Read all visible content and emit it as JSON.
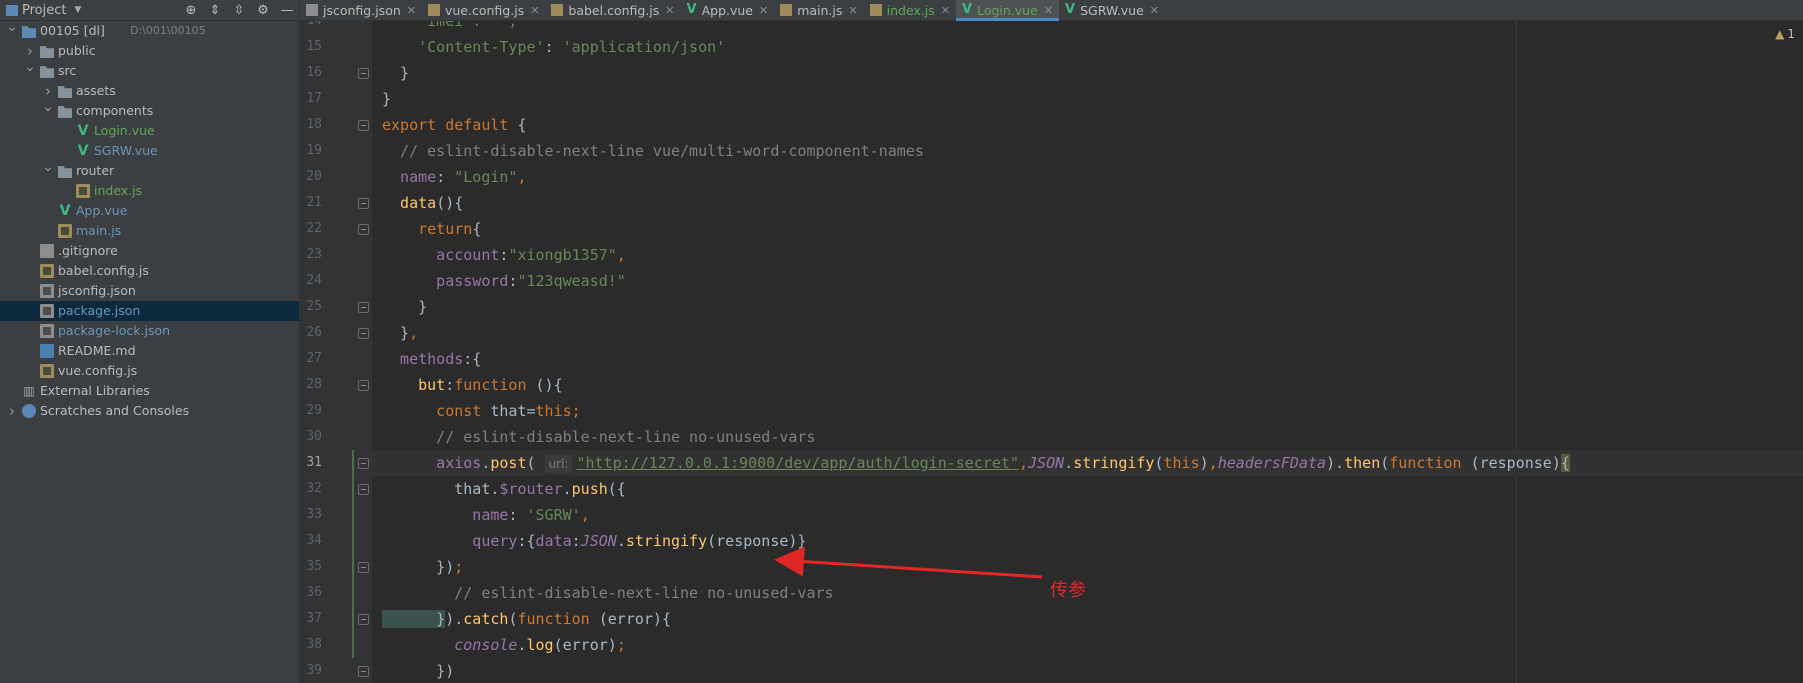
{
  "panel": {
    "title": "Project",
    "tree": [
      {
        "label": "00105 [dl]",
        "extra": "D:\\001\\00105",
        "icon": "project-folder-icon",
        "depth": 0,
        "arrow": "down",
        "color": "default"
      },
      {
        "label": "public",
        "icon": "folder-icon",
        "depth": 1,
        "arrow": "right",
        "color": "default"
      },
      {
        "label": "src",
        "icon": "folder-icon",
        "depth": 1,
        "arrow": "down",
        "color": "default"
      },
      {
        "label": "assets",
        "icon": "folder-icon",
        "depth": 2,
        "arrow": "right",
        "color": "default"
      },
      {
        "label": "components",
        "icon": "folder-icon",
        "depth": 2,
        "arrow": "down",
        "color": "default"
      },
      {
        "label": "Login.vue",
        "icon": "vue-icon",
        "depth": 3,
        "arrow": "",
        "color": "green"
      },
      {
        "label": "SGRW.vue",
        "icon": "vue-icon",
        "depth": 3,
        "arrow": "",
        "color": "blue"
      },
      {
        "label": "router",
        "icon": "folder-icon",
        "depth": 2,
        "arrow": "down",
        "color": "default"
      },
      {
        "label": "index.js",
        "icon": "js-icon",
        "depth": 3,
        "arrow": "",
        "color": "green"
      },
      {
        "label": "App.vue",
        "icon": "vue-icon",
        "depth": 2,
        "arrow": "",
        "color": "blue"
      },
      {
        "label": "main.js",
        "icon": "js-icon",
        "depth": 2,
        "arrow": "",
        "color": "blue"
      },
      {
        "label": ".gitignore",
        "icon": "git-icon",
        "depth": 1,
        "arrow": "",
        "color": "default"
      },
      {
        "label": "babel.config.js",
        "icon": "js-icon",
        "depth": 1,
        "arrow": "",
        "color": "default"
      },
      {
        "label": "jsconfig.json",
        "icon": "json-icon",
        "depth": 1,
        "arrow": "",
        "color": "default"
      },
      {
        "label": "package.json",
        "icon": "json-icon",
        "depth": 1,
        "arrow": "",
        "color": "blue",
        "selected": true
      },
      {
        "label": "package-lock.json",
        "icon": "json-icon",
        "depth": 1,
        "arrow": "",
        "color": "blue"
      },
      {
        "label": "README.md",
        "icon": "md-icon",
        "depth": 1,
        "arrow": "",
        "color": "default"
      },
      {
        "label": "vue.config.js",
        "icon": "js-icon",
        "depth": 1,
        "arrow": "",
        "color": "default"
      },
      {
        "label": "External Libraries",
        "icon": "lib-icon",
        "depth": 0,
        "arrow": "",
        "color": "default"
      },
      {
        "label": "Scratches and Consoles",
        "icon": "scratch-icon",
        "depth": 0,
        "arrow": "right",
        "color": "default"
      }
    ]
  },
  "tabs": [
    {
      "label": "jsconfig.json",
      "icon": "json",
      "active": false,
      "green": false
    },
    {
      "label": "vue.config.js",
      "icon": "js",
      "active": false,
      "green": false
    },
    {
      "label": "babel.config.js",
      "icon": "js",
      "active": false,
      "green": false
    },
    {
      "label": "App.vue",
      "icon": "vue",
      "active": false,
      "green": false
    },
    {
      "label": "main.js",
      "icon": "js",
      "active": false,
      "green": false
    },
    {
      "label": "index.js",
      "icon": "js",
      "active": false,
      "green": true
    },
    {
      "label": "Login.vue",
      "icon": "vue",
      "active": true,
      "green": true
    },
    {
      "label": "SGRW.vue",
      "icon": "vue",
      "active": false,
      "green": false
    }
  ],
  "editor": {
    "warning_count": "1",
    "current_line": 31,
    "lines": [
      {
        "n": "14",
        "tokens": [
          [
            "str",
            "    'imei': '',"
          ]
        ]
      },
      {
        "n": "15",
        "tokens": [
          [
            "str",
            "    'Content-Type'"
          ],
          [
            "plain",
            ": "
          ],
          [
            "str",
            "'application/json'"
          ]
        ]
      },
      {
        "n": "16",
        "tokens": [
          [
            "plain",
            "  }"
          ]
        ]
      },
      {
        "n": "17",
        "tokens": [
          [
            "plain",
            "}"
          ]
        ]
      },
      {
        "n": "18",
        "tokens": [
          [
            "kw",
            "export default "
          ],
          [
            "plain",
            "{"
          ]
        ]
      },
      {
        "n": "19",
        "tokens": [
          [
            "cmt",
            "  // eslint-disable-next-line vue/multi-word-component-names"
          ]
        ]
      },
      {
        "n": "20",
        "tokens": [
          [
            "prop",
            "  name"
          ],
          [
            "plain",
            ": "
          ],
          [
            "str",
            "\"Login\""
          ],
          [
            "kw",
            ","
          ]
        ]
      },
      {
        "n": "21",
        "tokens": [
          [
            "fn",
            "  data"
          ],
          [
            "plain",
            "(){"
          ]
        ]
      },
      {
        "n": "22",
        "tokens": [
          [
            "kw",
            "    return"
          ],
          [
            "plain",
            "{"
          ]
        ]
      },
      {
        "n": "23",
        "tokens": [
          [
            "prop",
            "      account"
          ],
          [
            "plain",
            ":"
          ],
          [
            "str",
            "\"xiongb1357\""
          ],
          [
            "kw",
            ","
          ]
        ]
      },
      {
        "n": "24",
        "tokens": [
          [
            "prop",
            "      password"
          ],
          [
            "plain",
            ":"
          ],
          [
            "str",
            "\"123qweasd!\""
          ]
        ]
      },
      {
        "n": "25",
        "tokens": [
          [
            "plain",
            "    }"
          ]
        ]
      },
      {
        "n": "26",
        "tokens": [
          [
            "plain",
            "  }"
          ],
          [
            "kw",
            ","
          ]
        ]
      },
      {
        "n": "27",
        "tokens": [
          [
            "prop",
            "  methods"
          ],
          [
            "plain",
            ":{"
          ]
        ]
      },
      {
        "n": "28",
        "tokens": [
          [
            "fn",
            "    but"
          ],
          [
            "plain",
            ":"
          ],
          [
            "kw",
            "function "
          ],
          [
            "plain",
            "(){"
          ]
        ]
      },
      {
        "n": "29",
        "tokens": [
          [
            "kw",
            "      const "
          ],
          [
            "plain",
            "that="
          ],
          [
            "kw",
            "this;"
          ]
        ]
      },
      {
        "n": "30",
        "tokens": [
          [
            "cmt",
            "      // eslint-disable-next-line no-unused-vars"
          ]
        ]
      },
      {
        "n": "31",
        "tokens": [
          [
            "prop",
            "      axios"
          ],
          [
            "plain",
            "."
          ],
          [
            "fn",
            "post"
          ],
          [
            "plain",
            "( "
          ],
          [
            "hint",
            "url:"
          ],
          [
            "strul",
            "\"http://127.0.0.1:9000/dev/app/auth/login-secret\""
          ],
          [
            "kw",
            ","
          ],
          [
            "ital",
            "JSON"
          ],
          [
            "plain",
            "."
          ],
          [
            "fn",
            "stringify"
          ],
          [
            "plain",
            "("
          ],
          [
            "kw",
            "this"
          ],
          [
            "plain",
            ")"
          ],
          [
            "kw",
            ","
          ],
          [
            "ital",
            "headersFData"
          ],
          [
            "plain",
            ")."
          ],
          [
            "fn",
            "then"
          ],
          [
            "plain",
            "("
          ],
          [
            "kw",
            "function "
          ],
          [
            "plain",
            "(response)"
          ],
          [
            "caret",
            "{"
          ]
        ]
      },
      {
        "n": "32",
        "tokens": [
          [
            "plain",
            "        that."
          ],
          [
            "prop",
            "$router"
          ],
          [
            "plain",
            "."
          ],
          [
            "fn",
            "push"
          ],
          [
            "plain",
            "({"
          ]
        ]
      },
      {
        "n": "33",
        "tokens": [
          [
            "prop",
            "          name"
          ],
          [
            "plain",
            ": "
          ],
          [
            "str",
            "'SGRW'"
          ],
          [
            "kw",
            ","
          ]
        ]
      },
      {
        "n": "34",
        "tokens": [
          [
            "prop",
            "          query"
          ],
          [
            "plain",
            ":{"
          ],
          [
            "prop",
            "data"
          ],
          [
            "plain",
            ":"
          ],
          [
            "ital",
            "JSON"
          ],
          [
            "plain",
            "."
          ],
          [
            "fn",
            "stringify"
          ],
          [
            "plain",
            "(response)}"
          ]
        ]
      },
      {
        "n": "35",
        "tokens": [
          [
            "plain",
            "      })"
          ],
          [
            "kw",
            ";"
          ]
        ]
      },
      {
        "n": "36",
        "tokens": [
          [
            "cmt",
            "        // eslint-disable-next-line no-unused-vars"
          ]
        ]
      },
      {
        "n": "37",
        "tokens": [
          [
            "match",
            "      }"
          ],
          [
            "plain",
            ")."
          ],
          [
            "fn",
            "catch"
          ],
          [
            "plain",
            "("
          ],
          [
            "kw",
            "function "
          ],
          [
            "plain",
            "(error){"
          ]
        ]
      },
      {
        "n": "38",
        "tokens": [
          [
            "ital",
            "        console"
          ],
          [
            "plain",
            "."
          ],
          [
            "fn",
            "log"
          ],
          [
            "plain",
            "(error)"
          ],
          [
            "kw",
            ";"
          ]
        ]
      },
      {
        "n": "39",
        "tokens": [
          [
            "plain",
            "      })"
          ]
        ]
      }
    ]
  },
  "annotation": {
    "label": "传参",
    "color": "#e02828"
  }
}
